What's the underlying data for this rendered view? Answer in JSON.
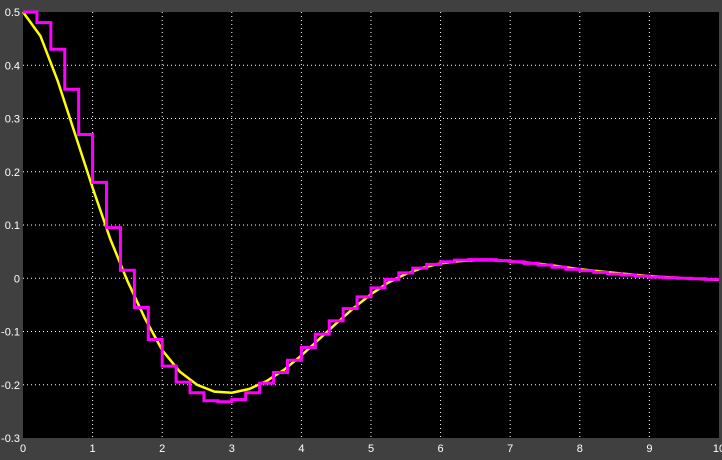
{
  "chart_data": {
    "type": "line",
    "title": "",
    "xlabel": "",
    "ylabel": "",
    "xlim": [
      0,
      10
    ],
    "ylim": [
      -0.3,
      0.5
    ],
    "x_ticks": [
      "0",
      "1",
      "2",
      "3",
      "4",
      "5",
      "6",
      "7",
      "8",
      "9",
      "10"
    ],
    "y_ticks": [
      "0.5",
      "0.4",
      "0.3",
      "0.2",
      "0.1",
      "0",
      "-0.1",
      "-0.2",
      "-0.3"
    ],
    "grid": true,
    "series": [
      {
        "style": "line",
        "color": "#ffff00",
        "x": [
          0,
          0.25,
          0.5,
          0.75,
          1,
          1.25,
          1.5,
          1.75,
          2,
          2.25,
          2.5,
          2.75,
          3,
          3.25,
          3.5,
          3.75,
          4,
          4.25,
          4.5,
          4.75,
          5,
          5.25,
          5.5,
          5.75,
          6,
          6.25,
          6.5,
          6.75,
          7,
          7.5,
          8,
          8.5,
          9,
          9.5,
          10
        ],
        "y": [
          0.5,
          0.455,
          0.37,
          0.27,
          0.17,
          0.075,
          -0.005,
          -0.075,
          -0.135,
          -0.175,
          -0.2,
          -0.213,
          -0.215,
          -0.208,
          -0.193,
          -0.172,
          -0.145,
          -0.115,
          -0.085,
          -0.056,
          -0.03,
          -0.008,
          0.008,
          0.02,
          0.028,
          0.032,
          0.034,
          0.034,
          0.032,
          0.026,
          0.017,
          0.01,
          0.004,
          0.0,
          -0.003
        ]
      },
      {
        "style": "step",
        "color": "#ff00ff",
        "x": [
          0,
          0.2,
          0.4,
          0.6,
          0.8,
          1.0,
          1.2,
          1.4,
          1.6,
          1.8,
          2.0,
          2.2,
          2.4,
          2.6,
          2.8,
          3.0,
          3.2,
          3.4,
          3.6,
          3.8,
          4.0,
          4.2,
          4.4,
          4.6,
          4.8,
          5.0,
          5.2,
          5.4,
          5.6,
          5.8,
          6.0,
          6.2,
          6.4,
          6.6,
          6.8,
          7.0,
          7.2,
          7.4,
          7.6,
          7.8,
          8.0,
          8.2,
          8.4,
          8.6,
          8.8,
          9.0,
          9.2,
          9.4,
          9.6,
          9.8,
          10
        ],
        "y": [
          0.5,
          0.48,
          0.43,
          0.355,
          0.27,
          0.18,
          0.095,
          0.015,
          -0.055,
          -0.115,
          -0.165,
          -0.195,
          -0.215,
          -0.23,
          -0.232,
          -0.228,
          -0.215,
          -0.197,
          -0.177,
          -0.154,
          -0.13,
          -0.105,
          -0.08,
          -0.057,
          -0.035,
          -0.018,
          -0.002,
          0.01,
          0.019,
          0.026,
          0.031,
          0.034,
          0.035,
          0.035,
          0.033,
          0.031,
          0.028,
          0.025,
          0.021,
          0.017,
          0.014,
          0.011,
          0.008,
          0.006,
          0.004,
          0.002,
          0.001,
          0.0,
          -0.001,
          -0.002,
          -0.002
        ]
      }
    ]
  },
  "colors": {
    "background": "#404040",
    "plot_area": "#000000",
    "grid": "#ffffff",
    "tick_text": "#ffffff"
  }
}
